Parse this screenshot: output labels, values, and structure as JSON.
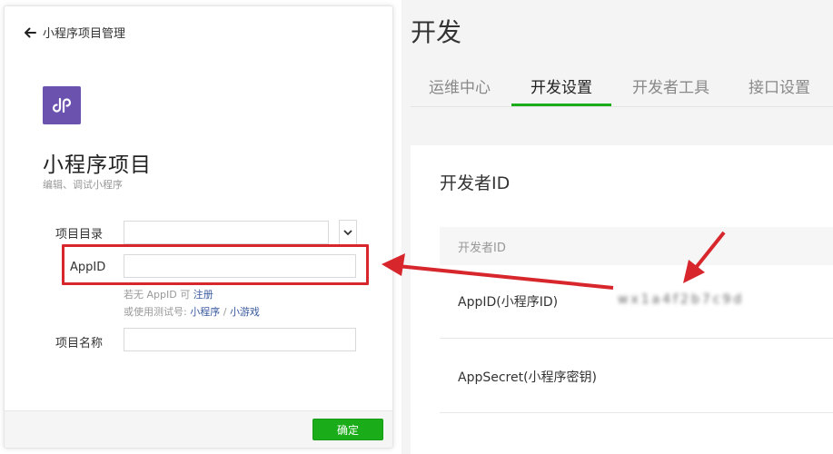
{
  "left_dialog": {
    "back_label": "小程序项目管理",
    "title": "小程序项目",
    "subtitle": "编辑、调试小程序",
    "fields": {
      "project_dir_label": "项目目录",
      "project_dir_value": "",
      "appid_label": "AppID",
      "appid_value": "",
      "project_name_label": "项目名称",
      "project_name_value": ""
    },
    "hint_line1_prefix": "若无 AppID 可",
    "hint_line1_link": "注册",
    "hint_line2_prefix": "或使用测试号:",
    "hint_line2_link1": "小程序",
    "hint_line2_sep": "/",
    "hint_line2_link2": "小游戏",
    "confirm_label": "确定"
  },
  "right_panel": {
    "title": "开发",
    "tabs": [
      {
        "label": "运维中心",
        "active": false
      },
      {
        "label": "开发设置",
        "active": true
      },
      {
        "label": "开发者工具",
        "active": false
      },
      {
        "label": "接口设置",
        "active": false
      }
    ],
    "section_title": "开发者ID",
    "table_header": "开发者ID",
    "rows": [
      {
        "label": "AppID(小程序ID)",
        "value": "wx1a4f2b7c9d"
      },
      {
        "label": "AppSecret(小程序密钥)",
        "value": ""
      }
    ]
  },
  "colors": {
    "accent_green": "#1aad19",
    "annotation_red": "#d7272d",
    "app_icon_purple": "#6b52ae",
    "link_blue": "#3a5b9f"
  },
  "icons": [
    "back-arrow-icon",
    "miniprogram-logo-icon",
    "chevron-down-icon"
  ]
}
